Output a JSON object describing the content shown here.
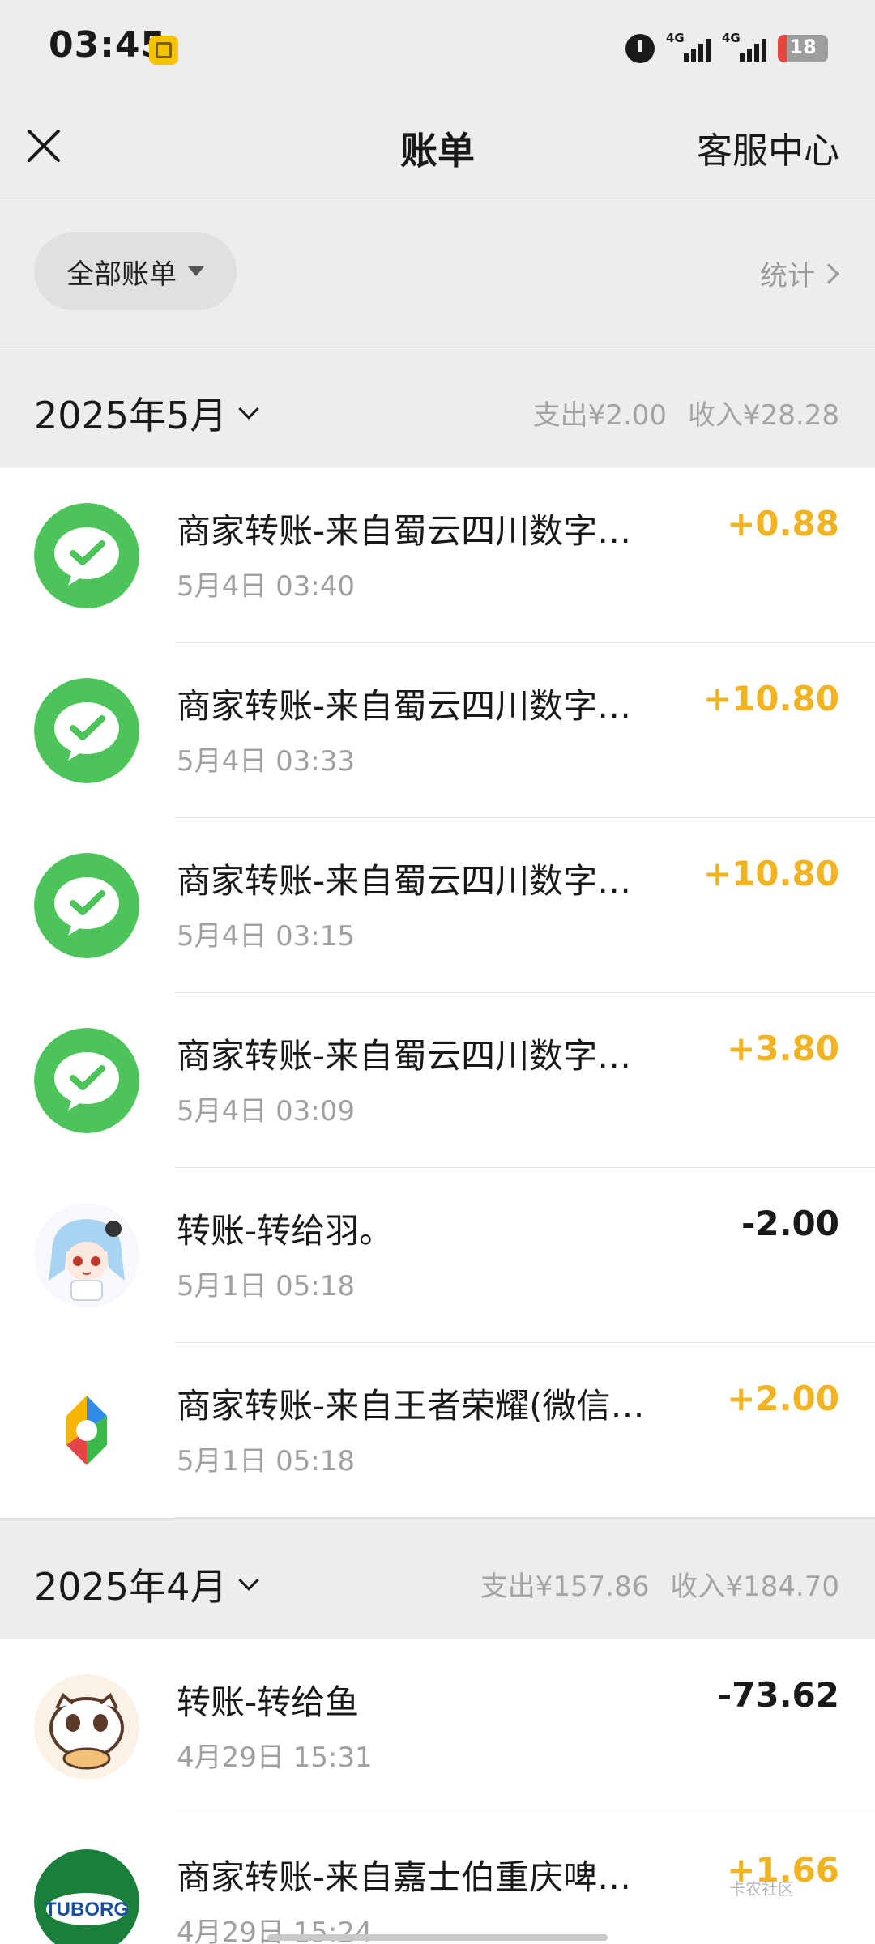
{
  "status": {
    "time": "03:45",
    "signal1": "4G",
    "signal2": "4G",
    "battery": "18",
    "battery_level": 0.18
  },
  "nav": {
    "title": "账单",
    "service": "客服中心"
  },
  "filter": {
    "label": "全部账单",
    "stats": "统计"
  },
  "months": [
    {
      "label": "2025年5月",
      "expense": "支出¥2.00",
      "income": "收入¥28.28",
      "items": [
        {
          "title": "商家转账-来自蜀云四川数字…",
          "time": "5月4日 03:40",
          "amount": "+0.88",
          "type": "in",
          "icon": "wechat-pay-icon"
        },
        {
          "title": "商家转账-来自蜀云四川数字…",
          "time": "5月4日 03:33",
          "amount": "+10.80",
          "type": "in",
          "icon": "wechat-pay-icon"
        },
        {
          "title": "商家转账-来自蜀云四川数字…",
          "time": "5月4日 03:15",
          "amount": "+10.80",
          "type": "in",
          "icon": "wechat-pay-icon"
        },
        {
          "title": "商家转账-来自蜀云四川数字…",
          "time": "5月4日 03:09",
          "amount": "+3.80",
          "type": "in",
          "icon": "wechat-pay-icon"
        },
        {
          "title": "转账-转给羽。",
          "time": "5月1日 05:18",
          "amount": "-2.00",
          "type": "out",
          "icon": "anime-avatar-icon"
        },
        {
          "title": "商家转账-来自王者荣耀(微信…",
          "time": "5月1日 05:18",
          "amount": "+2.00",
          "type": "in",
          "icon": "tencent-game-icon"
        }
      ]
    },
    {
      "label": "2025年4月",
      "expense": "支出¥157.86",
      "income": "收入¥184.70",
      "items": [
        {
          "title": "转账-转给鱼",
          "time": "4月29日 15:31",
          "amount": "-73.62",
          "type": "out",
          "icon": "cat-avatar-icon"
        },
        {
          "title": "商家转账-来自嘉士伯重庆啤…",
          "time": "4月29日 15:24",
          "amount": "+1.66",
          "type": "in",
          "icon": "tuborg-logo-icon",
          "logo_text": "TUBORG"
        }
      ]
    }
  ],
  "watermark": "卡农社区"
}
